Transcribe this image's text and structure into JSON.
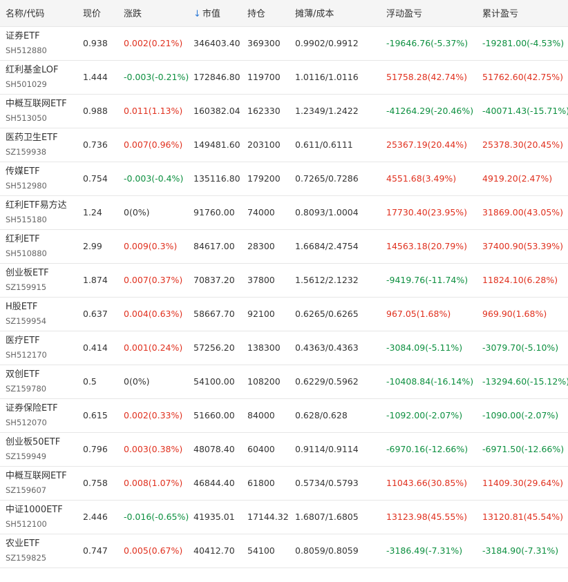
{
  "headers": {
    "name_code": "名称/代码",
    "price": "现价",
    "change": "涨跌",
    "market_value": "市值",
    "position": "持仓",
    "cost": "摊薄/成本",
    "floating_pl": "浮动盈亏",
    "cumulative_pl": "累计盈亏",
    "sort_arrow": "↓"
  },
  "colors": {
    "up": "#e0301e",
    "down": "#0c8f3f",
    "flat": "#333333",
    "header_bg": "#f5f5f5",
    "sort_arrow": "#2f7bd6"
  },
  "rows": [
    {
      "name": "证券ETF",
      "code": "SH512880",
      "price": "0.938",
      "change": "0.002(0.21%)",
      "change_dir": "up",
      "market_value": "346403.40",
      "position": "369300",
      "cost": "0.9902/0.9912",
      "floating_pl": "-19646.76(-5.37%)",
      "floating_dir": "down",
      "cumulative_pl": "-19281.00(-4.53%)",
      "cumulative_dir": "down"
    },
    {
      "name": "红利基金LOF",
      "code": "SH501029",
      "price": "1.444",
      "change": "-0.003(-0.21%)",
      "change_dir": "down",
      "market_value": "172846.80",
      "position": "119700",
      "cost": "1.0116/1.0116",
      "floating_pl": "51758.28(42.74%)",
      "floating_dir": "up",
      "cumulative_pl": "51762.60(42.75%)",
      "cumulative_dir": "up"
    },
    {
      "name": "中概互联网ETF",
      "code": "SH513050",
      "price": "0.988",
      "change": "0.011(1.13%)",
      "change_dir": "up",
      "market_value": "160382.04",
      "position": "162330",
      "cost": "1.2349/1.2422",
      "floating_pl": "-41264.29(-20.46%)",
      "floating_dir": "down",
      "cumulative_pl": "-40071.43(-15.71%)",
      "cumulative_dir": "down"
    },
    {
      "name": "医药卫生ETF",
      "code": "SZ159938",
      "price": "0.736",
      "change": "0.007(0.96%)",
      "change_dir": "up",
      "market_value": "149481.60",
      "position": "203100",
      "cost": "0.611/0.6111",
      "floating_pl": "25367.19(20.44%)",
      "floating_dir": "up",
      "cumulative_pl": "25378.30(20.45%)",
      "cumulative_dir": "up"
    },
    {
      "name": "传媒ETF",
      "code": "SH512980",
      "price": "0.754",
      "change": "-0.003(-0.4%)",
      "change_dir": "down",
      "market_value": "135116.80",
      "position": "179200",
      "cost": "0.7265/0.7286",
      "floating_pl": "4551.68(3.49%)",
      "floating_dir": "up",
      "cumulative_pl": "4919.20(2.47%)",
      "cumulative_dir": "up"
    },
    {
      "name": "红利ETF易方达",
      "code": "SH515180",
      "price": "1.24",
      "change": "0(0%)",
      "change_dir": "flat",
      "market_value": "91760.00",
      "position": "74000",
      "cost": "0.8093/1.0004",
      "floating_pl": "17730.40(23.95%)",
      "floating_dir": "up",
      "cumulative_pl": "31869.00(43.05%)",
      "cumulative_dir": "up"
    },
    {
      "name": "红利ETF",
      "code": "SH510880",
      "price": "2.99",
      "change": "0.009(0.3%)",
      "change_dir": "up",
      "market_value": "84617.00",
      "position": "28300",
      "cost": "1.6684/2.4754",
      "floating_pl": "14563.18(20.79%)",
      "floating_dir": "up",
      "cumulative_pl": "37400.90(53.39%)",
      "cumulative_dir": "up"
    },
    {
      "name": "创业板ETF",
      "code": "SZ159915",
      "price": "1.874",
      "change": "0.007(0.37%)",
      "change_dir": "up",
      "market_value": "70837.20",
      "position": "37800",
      "cost": "1.5612/2.1232",
      "floating_pl": "-9419.76(-11.74%)",
      "floating_dir": "down",
      "cumulative_pl": "11824.10(6.28%)",
      "cumulative_dir": "up"
    },
    {
      "name": "H股ETF",
      "code": "SZ159954",
      "price": "0.637",
      "change": "0.004(0.63%)",
      "change_dir": "up",
      "market_value": "58667.70",
      "position": "92100",
      "cost": "0.6265/0.6265",
      "floating_pl": "967.05(1.68%)",
      "floating_dir": "up",
      "cumulative_pl": "969.90(1.68%)",
      "cumulative_dir": "up"
    },
    {
      "name": "医疗ETF",
      "code": "SH512170",
      "price": "0.414",
      "change": "0.001(0.24%)",
      "change_dir": "up",
      "market_value": "57256.20",
      "position": "138300",
      "cost": "0.4363/0.4363",
      "floating_pl": "-3084.09(-5.11%)",
      "floating_dir": "down",
      "cumulative_pl": "-3079.70(-5.10%)",
      "cumulative_dir": "down"
    },
    {
      "name": "双创ETF",
      "code": "SZ159780",
      "price": "0.5",
      "change": "0(0%)",
      "change_dir": "flat",
      "market_value": "54100.00",
      "position": "108200",
      "cost": "0.6229/0.5962",
      "floating_pl": "-10408.84(-16.14%)",
      "floating_dir": "down",
      "cumulative_pl": "-13294.60(-15.12%)",
      "cumulative_dir": "down"
    },
    {
      "name": "证券保险ETF",
      "code": "SH512070",
      "price": "0.615",
      "change": "0.002(0.33%)",
      "change_dir": "up",
      "market_value": "51660.00",
      "position": "84000",
      "cost": "0.628/0.628",
      "floating_pl": "-1092.00(-2.07%)",
      "floating_dir": "down",
      "cumulative_pl": "-1090.00(-2.07%)",
      "cumulative_dir": "down"
    },
    {
      "name": "创业板50ETF",
      "code": "SZ159949",
      "price": "0.796",
      "change": "0.003(0.38%)",
      "change_dir": "up",
      "market_value": "48078.40",
      "position": "60400",
      "cost": "0.9114/0.9114",
      "floating_pl": "-6970.16(-12.66%)",
      "floating_dir": "down",
      "cumulative_pl": "-6971.50(-12.66%)",
      "cumulative_dir": "down"
    },
    {
      "name": "中概互联网ETF",
      "code": "SZ159607",
      "price": "0.758",
      "change": "0.008(1.07%)",
      "change_dir": "up",
      "market_value": "46844.40",
      "position": "61800",
      "cost": "0.5734/0.5793",
      "floating_pl": "11043.66(30.85%)",
      "floating_dir": "up",
      "cumulative_pl": "11409.30(29.64%)",
      "cumulative_dir": "up"
    },
    {
      "name": "中证1000ETF",
      "code": "SH512100",
      "price": "2.446",
      "change": "-0.016(-0.65%)",
      "change_dir": "down",
      "market_value": "41935.01",
      "position": "17144.32",
      "cost": "1.6807/1.6805",
      "floating_pl": "13123.98(45.55%)",
      "floating_dir": "up",
      "cumulative_pl": "13120.81(45.54%)",
      "cumulative_dir": "up"
    },
    {
      "name": "农业ETF",
      "code": "SZ159825",
      "price": "0.747",
      "change": "0.005(0.67%)",
      "change_dir": "up",
      "market_value": "40412.70",
      "position": "54100",
      "cost": "0.8059/0.8059",
      "floating_pl": "-3186.49(-7.31%)",
      "floating_dir": "down",
      "cumulative_pl": "-3184.90(-7.31%)",
      "cumulative_dir": "down"
    }
  ]
}
